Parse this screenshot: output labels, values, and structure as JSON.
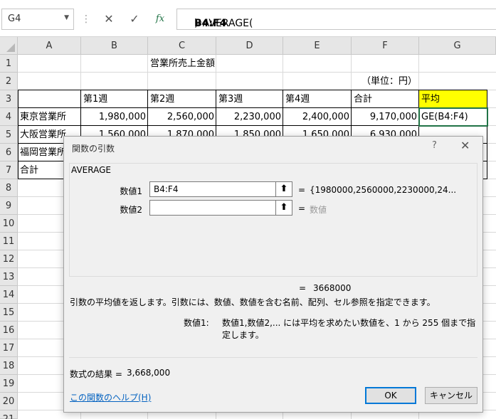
{
  "formula_bar": {
    "name_box": "G4",
    "cancel_icon": "✕",
    "enter_icon": "✓",
    "fx_icon": "fx",
    "formula_prefix": "=AVERAGE(",
    "formula_ref": "B4:F4",
    "formula_suffix": ")"
  },
  "columns": [
    "A",
    "B",
    "C",
    "D",
    "E",
    "F",
    "G"
  ],
  "rows": [
    "1",
    "2",
    "3",
    "4",
    "5",
    "6",
    "7",
    "8",
    "9",
    "10",
    "11",
    "12",
    "13",
    "14",
    "15",
    "16",
    "17",
    "18",
    "19",
    "20",
    "21"
  ],
  "sheet": {
    "title": "営業所売上金額",
    "unit": "（単位：円）",
    "headers": [
      "第1週",
      "第2週",
      "第3週",
      "第4週",
      "合計",
      "平均"
    ],
    "rows": [
      {
        "label": "東京営業所",
        "values": [
          "1,980,000",
          "2,560,000",
          "2,230,000",
          "2,400,000",
          "9,170,000"
        ],
        "avg": "GE(B4:F4)"
      },
      {
        "label": "大阪営業所",
        "values": [
          "1,560,000",
          "1,870,000",
          "1,850,000",
          "1,650,000",
          "6,930,000"
        ]
      },
      {
        "label": "福岡営業所"
      },
      {
        "label": "合計"
      }
    ]
  },
  "dialog": {
    "title": "関数の引数",
    "help": "?",
    "close": "✕",
    "function_name": "AVERAGE",
    "arg1_label": "数値1",
    "arg1_value": "B4:F4",
    "arg1_eq": "=",
    "arg1_result": "{1980000,2560000,2230000,24...",
    "arg2_label": "数値2",
    "arg2_value": "",
    "arg2_eq": "=",
    "arg2_result": "数値",
    "ref_icon": "⬆",
    "result_eq": "=",
    "result_value": "3668000",
    "description": "引数の平均値を返します。引数には、数値、数値を含む名前、配列、セル参照を指定できます。",
    "arg_desc_label": "数値1:",
    "arg_desc_text": "数値1,数値2,... には平均を求めたい数値を、1 から 255 個まで指定します。",
    "formula_result_label": "数式の結果 =",
    "formula_result_value": "3,668,000",
    "help_link": "この関数のヘルプ(H)",
    "ok": "OK",
    "cancel": "キャンセル"
  }
}
